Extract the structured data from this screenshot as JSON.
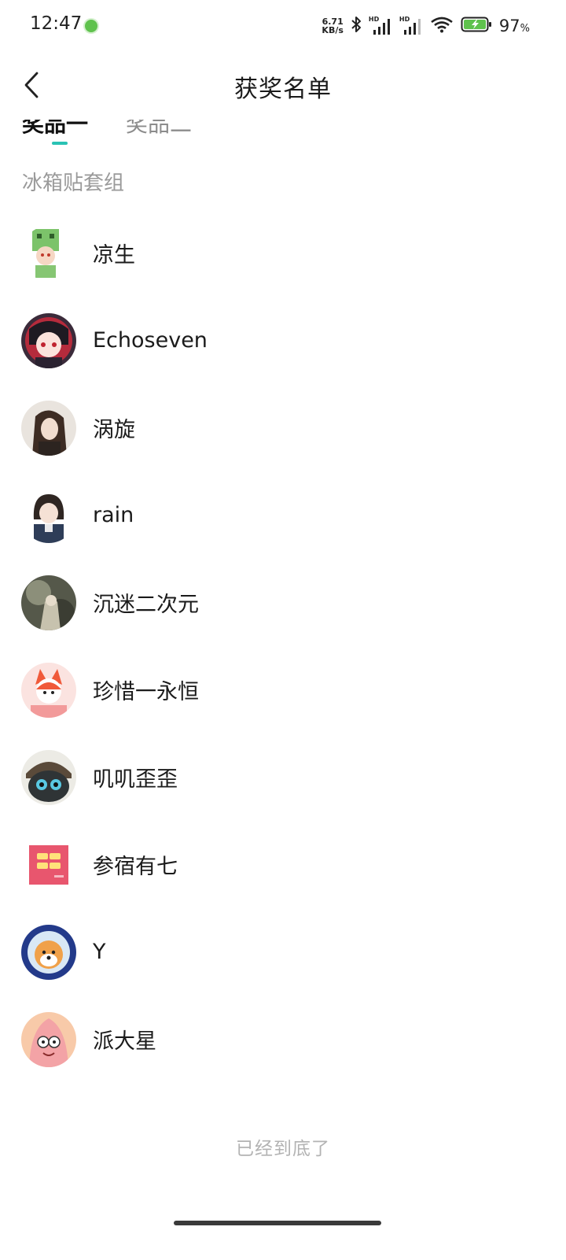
{
  "status_bar": {
    "time": "12:47",
    "net_speed_value": "6.71",
    "net_speed_unit": "KB/s",
    "sim1_label": "HD",
    "sim2_label": "HD",
    "battery_percent": "97",
    "battery_percent_sign": "%",
    "accent_color": "#5fc24d"
  },
  "header": {
    "title": "获奖名单",
    "back_icon": "chevron-left-icon"
  },
  "tabs": [
    {
      "label": "奖品一",
      "active": true
    },
    {
      "label": "奖品二",
      "active": false
    }
  ],
  "tab_indicator_color": "#29c2b4",
  "section": {
    "title": "冰箱贴套组"
  },
  "winners": [
    {
      "name": "凉生"
    },
    {
      "name": "Echoseven"
    },
    {
      "name": "涡旋"
    },
    {
      "name": "rain"
    },
    {
      "name": "沉迷二次元"
    },
    {
      "name": "珍惜一永恒"
    },
    {
      "name": "叽叽歪歪"
    },
    {
      "name": "参宿有七"
    },
    {
      "name": "Y"
    },
    {
      "name": "派大星"
    }
  ],
  "footer": {
    "end_text": "已经到底了"
  }
}
